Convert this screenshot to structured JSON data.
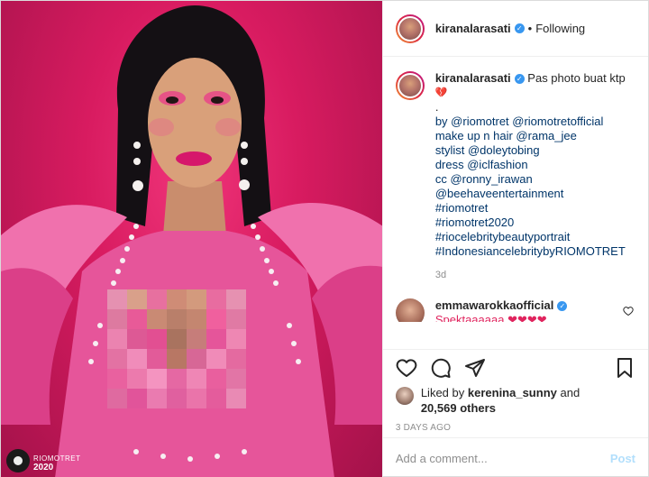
{
  "header": {
    "username": "kiranalarasati",
    "separator": "•",
    "follow_status": "Following"
  },
  "caption": {
    "username": "kiranalarasati",
    "lines": [
      "Pas photo buat ktp",
      "💔",
      ".",
      "by @riomotret @riomotretofficial",
      "make up n hair @rama_jee",
      "stylist @doleytobing",
      "dress @iclfashion",
      "cc @ronny_irawan",
      "@beehaveentertainment",
      "#riomotret",
      "#riomotret2020",
      "#riocelebritybeautyportrait",
      "#IndonesiancelebritybyRIOMOTRET"
    ],
    "time": "3d"
  },
  "comment": {
    "username": "emmawarokkaofficial",
    "text": "Spektaaaaaa ❤❤❤❤"
  },
  "actions": [
    "heart-icon",
    "comment-icon",
    "share-icon",
    "bookmark-icon"
  ],
  "likes": {
    "prefix": "Liked by",
    "user": "kerenina_sunny",
    "and": "and",
    "count": "20,569 others"
  },
  "date": "3 DAYS AGO",
  "add_comment": {
    "placeholder": "Add a comment...",
    "post_label": "Post"
  },
  "watermark": {
    "text": "RIOMOTRET",
    "year": "2020"
  },
  "colors": {
    "background_pink": "#d81b60",
    "verified_blue": "#3897f0",
    "link": "#003569",
    "muted": "#8e8e8e",
    "post_button": "#b2dffc"
  }
}
